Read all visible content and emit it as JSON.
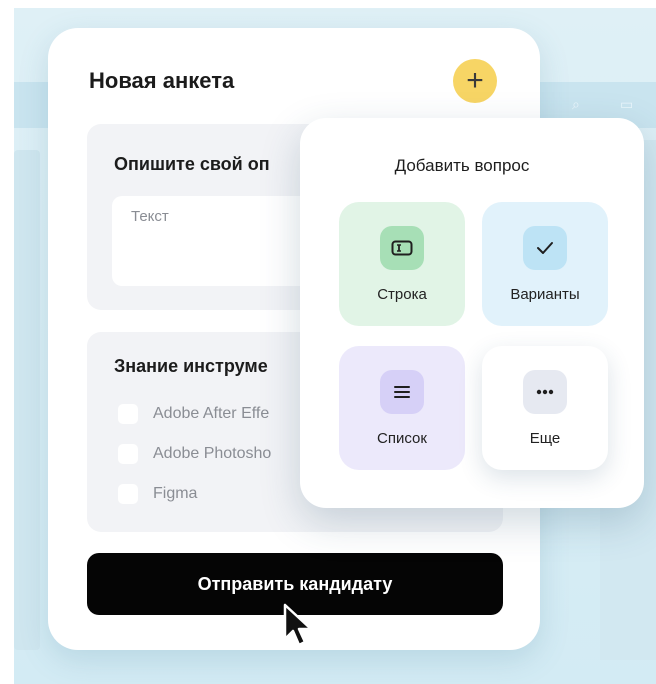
{
  "form": {
    "title": "Новая анкета",
    "add_button_label": "+",
    "question_1": {
      "title": "Опишите свой оп",
      "placeholder": "Текст"
    },
    "question_2": {
      "title": "Знание инструме",
      "options": [
        "Adobe After Effe",
        "Adobe Photosho",
        "Figma"
      ]
    },
    "submit_label": "Отправить кандидату"
  },
  "popup": {
    "title": "Добавить вопрос",
    "tiles": [
      {
        "label": "Строка",
        "icon": "text-field-icon"
      },
      {
        "label": "Варианты",
        "icon": "checkmark-icon"
      },
      {
        "label": "Список",
        "icon": "list-icon"
      },
      {
        "label": "Еще",
        "icon": "more-dots-icon"
      }
    ]
  },
  "colors": {
    "accent_yellow": "#f7d565",
    "submit_bg": "#050505",
    "tile_row": "#e1f4e6",
    "tile_variants": "#e1f2fb",
    "tile_list": "#ece9fb"
  }
}
